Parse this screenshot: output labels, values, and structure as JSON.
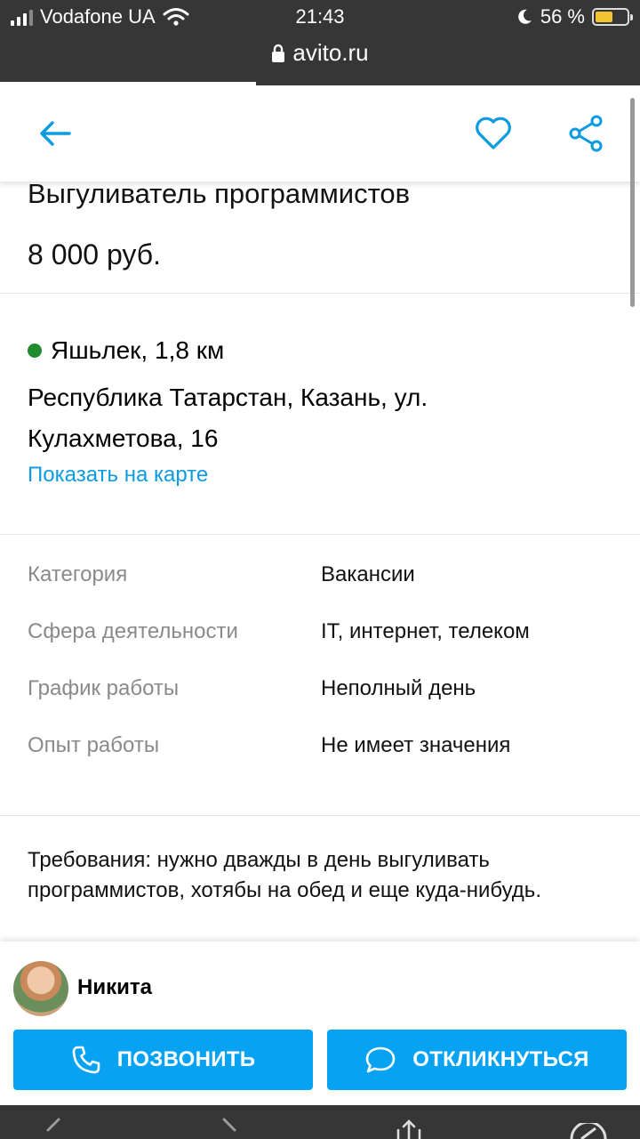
{
  "status_bar": {
    "carrier": "Vodafone UA",
    "time": "21:43",
    "battery": "56 %",
    "battery_level": 0.56
  },
  "url_bar": {
    "domain": "avito.ru"
  },
  "header": {
    "icons": [
      "arrow-left-icon",
      "heart-icon",
      "share-icon"
    ]
  },
  "listing": {
    "title": "Выгуливатель программистов",
    "price": "8 000 руб."
  },
  "location": {
    "metro": "Яшьлек, 1,8 км",
    "metro_color": "#1f8a2e",
    "address": "Республика Татарстан, Казань, ул. Кулахметова, 16",
    "map_link": "Показать на карте"
  },
  "params": [
    {
      "key": "Категория",
      "value": "Вакансии"
    },
    {
      "key": "Сфера деятельности",
      "value": "IT, интернет, телеком"
    },
    {
      "key": "График работы",
      "value": "Неполный день"
    },
    {
      "key": "Опыт работы",
      "value": "Не имеет значения"
    }
  ],
  "description": "Требования: нужно дважды в день выгуливать программистов, хотябы на обед и еще куда-нибудь.",
  "contact": {
    "name": "Никита",
    "call_label": "ПОЗВОНИТЬ",
    "reply_label": "ОТКЛИКНУТЬСЯ"
  },
  "colors": {
    "accent": "#08a2f2",
    "link": "#0a9be1"
  }
}
